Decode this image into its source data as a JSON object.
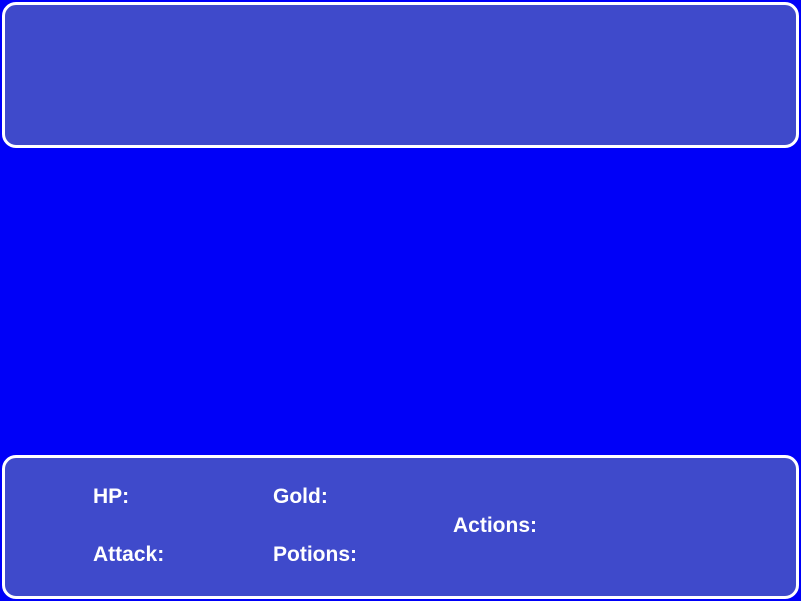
{
  "stats": {
    "hp_label": "HP:",
    "attack_label": "Attack:",
    "gold_label": "Gold:",
    "potions_label": "Potions:",
    "actions_label": "Actions:"
  },
  "colors": {
    "background": "#0000f8",
    "panel": "#3f4acb",
    "border": "#ffffff",
    "text": "#ffffff"
  }
}
